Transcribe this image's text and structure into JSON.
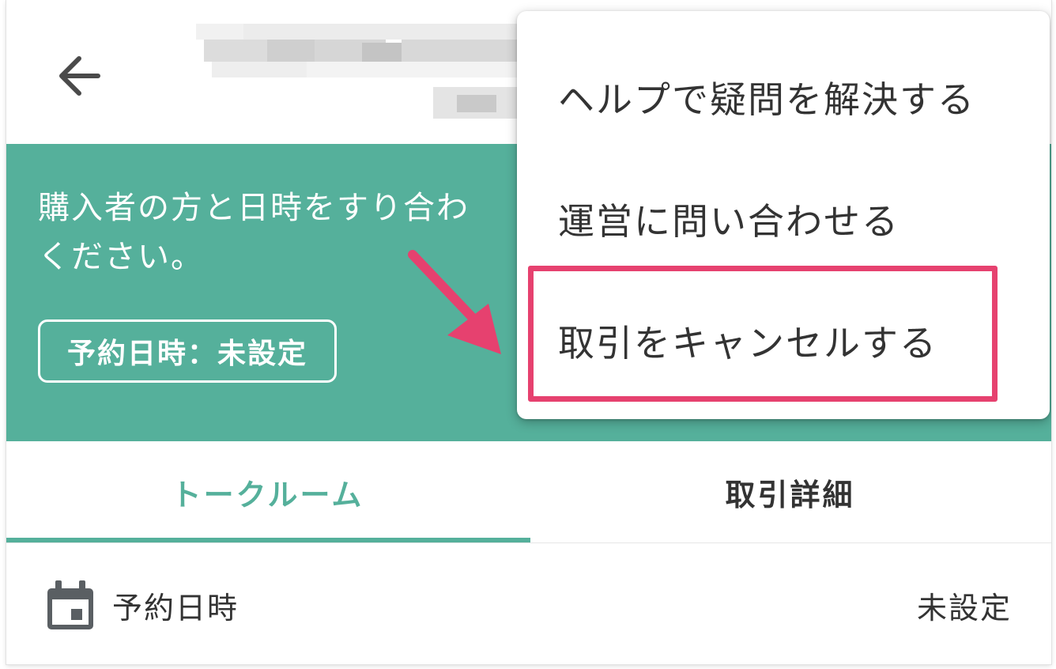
{
  "header": {
    "back_icon": "arrow-left-icon"
  },
  "banner": {
    "message": "購入者の方と日時をすり合わ\nください。",
    "reservation_badge": "予約日時：未設定"
  },
  "tabs": [
    {
      "label": "トークルーム",
      "active": true
    },
    {
      "label": "取引詳細",
      "active": false
    }
  ],
  "info": {
    "icon": "calendar-icon",
    "label": "予約日時",
    "value": "未設定"
  },
  "menu": {
    "items": [
      {
        "label": "ヘルプで疑問を解決する"
      },
      {
        "label": "運営に問い合わせる"
      },
      {
        "label": "取引をキャンセルする"
      }
    ]
  },
  "colors": {
    "accent_green": "#55b09b",
    "highlight_pink": "#e6416f",
    "inactive_tab_text": "#333333"
  }
}
